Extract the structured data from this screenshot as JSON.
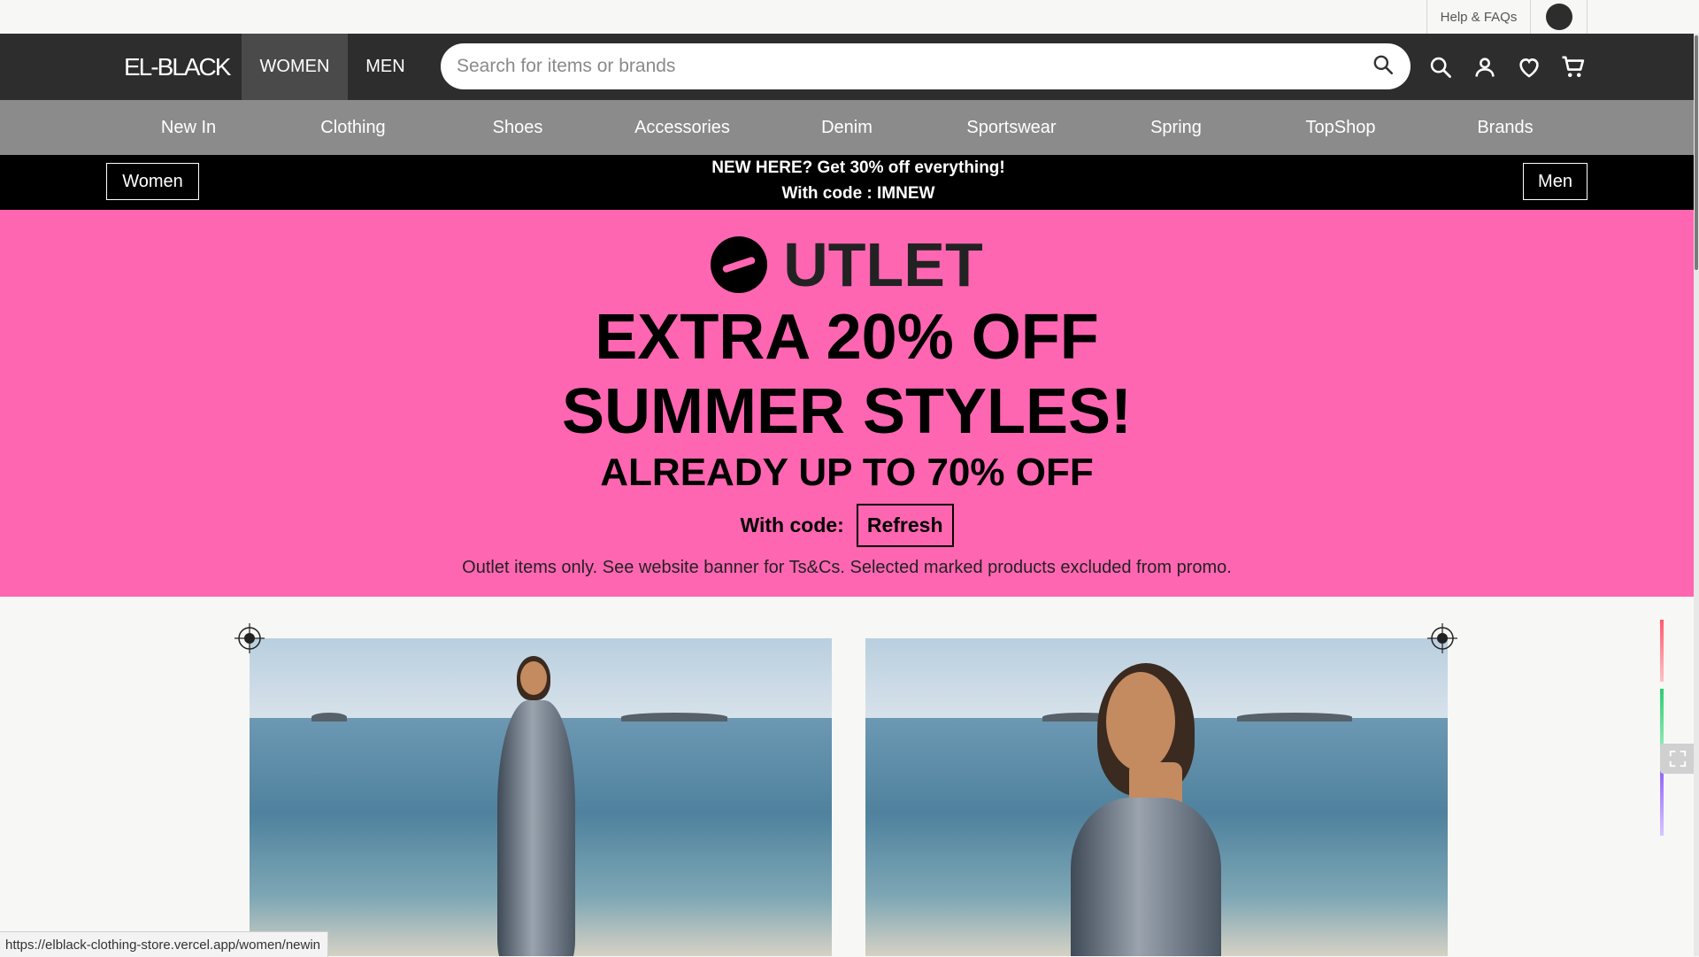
{
  "utility": {
    "help_label": "Help & FAQs"
  },
  "header": {
    "logo": "EL-BLACK",
    "tabs": [
      {
        "label": "WOMEN",
        "active": true
      },
      {
        "label": "MEN",
        "active": false
      }
    ],
    "search_placeholder": "Search for items or brands",
    "icons": [
      "search-icon",
      "account-icon",
      "wishlist-heart-icon",
      "cart-icon"
    ]
  },
  "categories": [
    "New In",
    "Clothing",
    "Shoes",
    "Accessories",
    "Denim",
    "Sportswear",
    "Spring",
    "TopShop",
    "Brands"
  ],
  "promo": {
    "line1": "NEW HERE? Get 30% off everything!",
    "line2": "With code : IMNEW",
    "left_button": "Women",
    "right_button": "Men"
  },
  "hero": {
    "outlet": "UTLET",
    "line1": "EXTRA 20% OFF",
    "line2": "SUMMER STYLES!",
    "line3": "ALREADY UP TO 70% OFF",
    "code_label": "With code:",
    "code_value": "Refresh",
    "note": "Outlet items only. See website banner for Ts&Cs. Selected marked products excluded from promo."
  },
  "status_bar": {
    "url": "https://elblack-clothing-store.vercel.app/women/newin"
  },
  "colors": {
    "header_bg": "#2d2d2d",
    "nav_bg": "#8b8b8b",
    "hero_bg": "#ff66b2",
    "promo_bg": "#000000"
  }
}
